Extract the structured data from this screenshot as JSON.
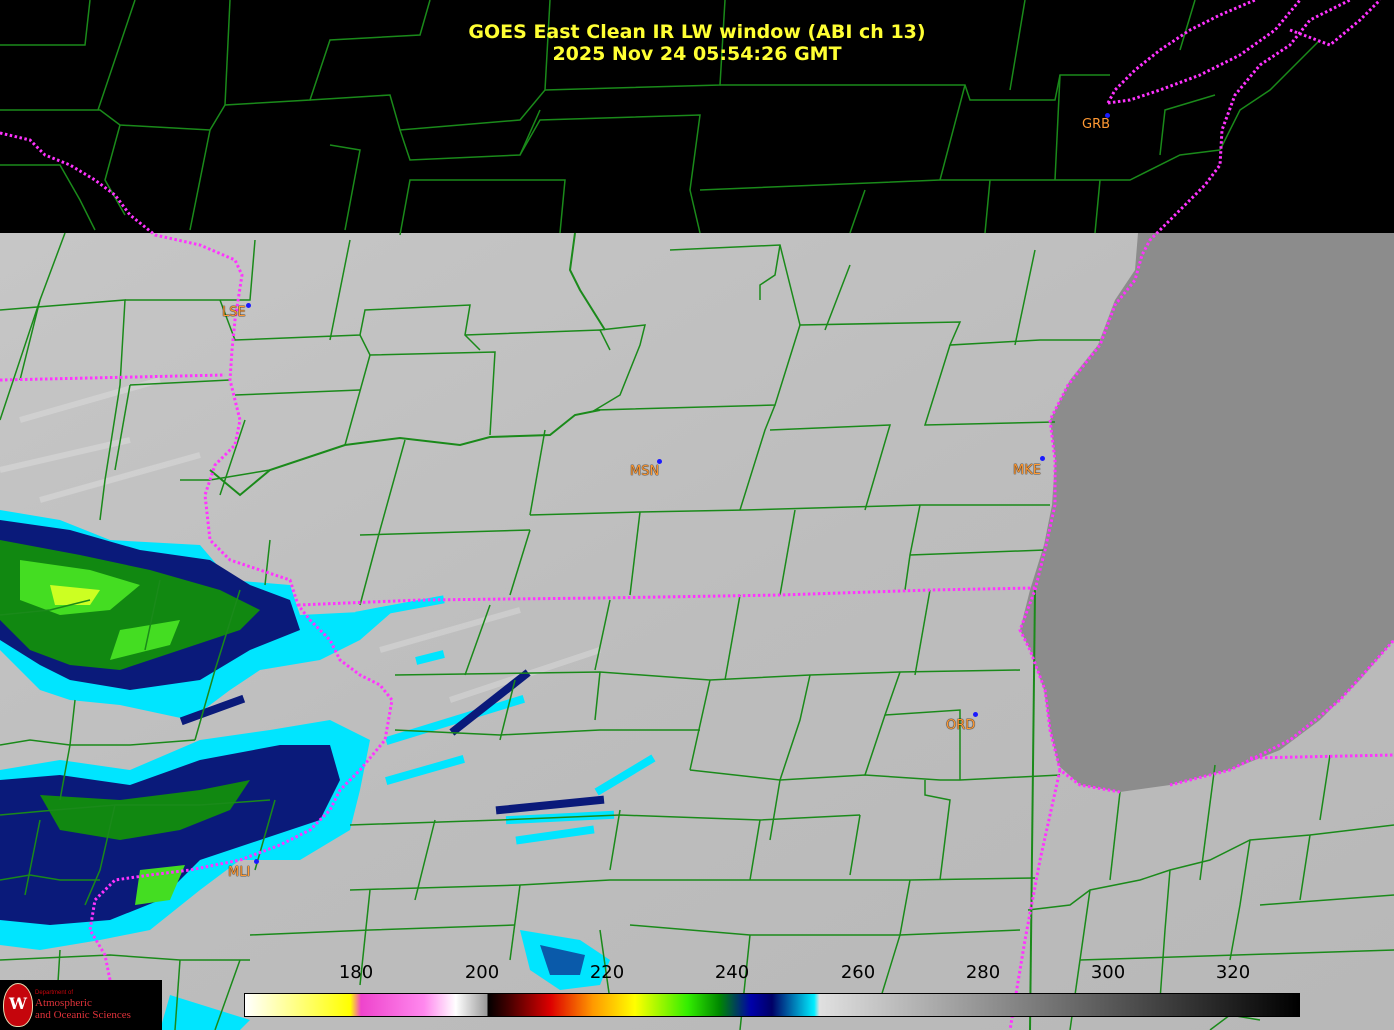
{
  "title": {
    "line1": "GOES East Clean IR LW window (ABI ch 13)",
    "line2": "2025 Nov 24  05:54:26 GMT"
  },
  "cities": [
    {
      "id": "grb",
      "label": "GRB",
      "color": "#ff9933"
    },
    {
      "id": "lse",
      "label": "LSE",
      "color": "#ff9933"
    },
    {
      "id": "msn",
      "label": "MSN",
      "color": "#ff9933"
    },
    {
      "id": "mke",
      "label": "MKE",
      "color": "#ff9933"
    },
    {
      "id": "ord",
      "label": "ORD",
      "color": "#ff9933"
    },
    {
      "id": "mli",
      "label": "MLI",
      "color": "#ff9933"
    }
  ],
  "colorbar": {
    "ticks": [
      "180",
      "200",
      "220",
      "240",
      "260",
      "280",
      "300",
      "320"
    ]
  },
  "logo": {
    "crest": "W",
    "line_small": "Department of",
    "line1": "Atmospheric",
    "line2": "and Oceanic Sciences"
  },
  "colors": {
    "title": "#ffff33",
    "state_border": "#ff33ff",
    "county_border": "#1a8a1a",
    "city_label": "#ff9933",
    "city_dot": "#1a1aff",
    "cloud_warm": "#00e5ff",
    "cloud_mid": "#0a1a7a",
    "cloud_cold": "#44dd22",
    "cloud_coldest": "#ccff22"
  }
}
